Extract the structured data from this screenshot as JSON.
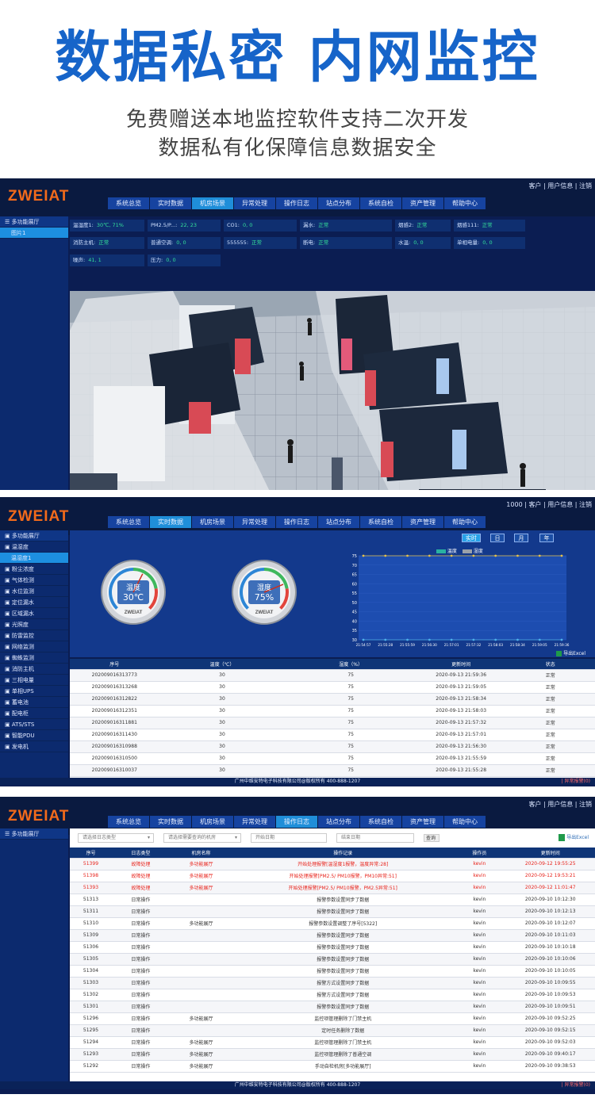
{
  "hero": {
    "title": "数据私密 内网监控",
    "subtitle1": "免费赠送本地监控软件支持二次开发",
    "subtitle2": "数据私有化保障信息数据安全"
  },
  "brand": {
    "logo": "ZWEIAT",
    "accent": "#f26a1b",
    "nav_active": "#1f8ed9"
  },
  "nav": [
    "系统总览",
    "实时数据",
    "机房场景",
    "异常处理",
    "操作日志",
    "站点分布",
    "系统自检",
    "资产管理",
    "帮助中心"
  ],
  "panel1": {
    "user_links": "客户 | 用户信息 | 注销",
    "sidebar": [
      "多功能展厅",
      "图片1"
    ],
    "sensors": [
      {
        "label": "温湿度1:",
        "value": "30℃, 71%"
      },
      {
        "label": "PM2.5/P...:",
        "value": "22, 23"
      },
      {
        "label": "CO1:",
        "value": "0, 0"
      },
      {
        "label": "漏水:",
        "value": "正常"
      },
      {
        "label": "烟感2:",
        "value": "正常"
      },
      {
        "label": "烟感111:",
        "value": "正常"
      },
      {
        "label": "消防主机:",
        "value": "正常"
      },
      {
        "label": "普通空调:",
        "value": "0, 0"
      },
      {
        "label": "555555:",
        "value": "正常"
      },
      {
        "label": "断电:",
        "value": "正常"
      },
      {
        "label": "水温:",
        "value": "0, 0"
      },
      {
        "label": "单相电量:",
        "value": "0, 0"
      },
      {
        "label": "噪声:",
        "value": "41, 1"
      },
      {
        "label": "压力:",
        "value": "0, 0"
      }
    ]
  },
  "panel2": {
    "user_links": "1000 | 客户 | 用户信息 | 注销",
    "sidebar": [
      "多功能展厅",
      "温湿度",
      "温湿度1",
      "粉尘浓度",
      "气体检测",
      "水位监测",
      "定位漏水",
      "区域漏水",
      "光照度",
      "防雷监控",
      "网络监测",
      "蜘蛛监测",
      "消防主机",
      "三相电量",
      "单相UPS",
      "蓄电池",
      "配电柜",
      "ATS/STS",
      "智能PDU",
      "发电机"
    ],
    "gauges": [
      {
        "label": "温度",
        "value": "30℃",
        "brand": "ZWEIAT",
        "level": 0.6
      },
      {
        "label": "湿度",
        "value": "75%",
        "brand": "ZWEIAT",
        "level": 0.75
      }
    ],
    "time_buttons": [
      "实时",
      "日",
      "月",
      "年"
    ],
    "legend": [
      "温度",
      "湿度"
    ],
    "chart_data": {
      "type": "line",
      "x": [
        "21:54:57",
        "21:55:28",
        "21:55:59",
        "21:56:30",
        "21:57:01",
        "21:57:32",
        "21:58:03",
        "21:58:34",
        "21:59:05",
        "21:59:36"
      ],
      "series": [
        {
          "name": "温度",
          "values": [
            75,
            75,
            75,
            75,
            75,
            75,
            75,
            75,
            75,
            75
          ]
        },
        {
          "name": "湿度",
          "values": [
            30,
            30,
            30,
            30,
            30,
            30,
            30,
            30,
            30,
            30
          ]
        }
      ],
      "yticks": [
        "75",
        "70",
        "65",
        "60",
        "55",
        "50",
        "45",
        "40",
        "35",
        "30"
      ],
      "ylim": [
        30,
        75
      ]
    },
    "export_label": "导出Excel",
    "table_headers": [
      "序号",
      "温度（℃）",
      "湿度（%）",
      "更新时间",
      "状态"
    ],
    "rows": [
      [
        "202009016313773",
        "30",
        "75",
        "2020-09-13 21:59:36",
        "正常"
      ],
      [
        "202009016313268",
        "30",
        "75",
        "2020-09-13 21:59:05",
        "正常"
      ],
      [
        "202009016312822",
        "30",
        "75",
        "2020-09-13 21:58:34",
        "正常"
      ],
      [
        "202009016312351",
        "30",
        "75",
        "2020-09-13 21:58:03",
        "正常"
      ],
      [
        "202009016311881",
        "30",
        "75",
        "2020-09-13 21:57:32",
        "正常"
      ],
      [
        "202009016311430",
        "30",
        "75",
        "2020-09-13 21:57:01",
        "正常"
      ],
      [
        "202009016310988",
        "30",
        "75",
        "2020-09-13 21:56:30",
        "正常"
      ],
      [
        "202009016310500",
        "30",
        "75",
        "2020-09-13 21:55:59",
        "正常"
      ],
      [
        "202009016310037",
        "30",
        "75",
        "2020-09-13 21:55:28",
        "正常"
      ]
    ],
    "footer": "广州中维安特电子科技有限公司@版权所有 400-888-1207",
    "alarm": "| 异常报警(0)"
  },
  "panel3": {
    "user_links": "客户 | 用户信息 | 注销",
    "sidebar": [
      "多功能展厅"
    ],
    "filters": {
      "type_placeholder": "请选择日志类型",
      "room_placeholder": "请选择需要查询的机房",
      "start_placeholder": "开始日期",
      "end_placeholder": "结束日期",
      "query": "查询",
      "export": "导出Excel"
    },
    "table_headers": [
      "序号",
      "日志类型",
      "机房名称",
      "操作记录",
      "操作员",
      "更新时间"
    ],
    "rows": [
      [
        "51399",
        "故障处理",
        "多功能展厅",
        "开始处理报警[温湿度1报警，温度异常:28]",
        "kevin",
        "2020-09-12 19:55:25",
        "red"
      ],
      [
        "51398",
        "故障处理",
        "多功能展厅",
        "开始处理报警[PM2.5/ PM10报警，PM10异常:51]",
        "kevin",
        "2020-09-12 19:53:21",
        "red"
      ],
      [
        "51393",
        "故障处理",
        "多功能展厅",
        "开始处理报警[PM2.5/ PM10报警，PM2.5异常:51]",
        "kevin",
        "2020-09-12 11:01:47",
        "red"
      ],
      [
        "51313",
        "日常操作",
        "",
        "报警参数设置同步了数据",
        "kevin",
        "2020-09-10 10:12:30",
        ""
      ],
      [
        "51311",
        "日常操作",
        "",
        "报警参数设置同步了数据",
        "kevin",
        "2020-09-10 10:12:13",
        ""
      ],
      [
        "51310",
        "日常操作",
        "多功能展厅",
        "报警参数设置调整了序号[5322]",
        "kevin",
        "2020-09-10 10:12:07",
        ""
      ],
      [
        "51309",
        "日常操作",
        "",
        "报警参数设置同步了数据",
        "kevin",
        "2020-09-10 10:11:03",
        ""
      ],
      [
        "51306",
        "日常操作",
        "",
        "报警参数设置同步了数据",
        "kevin",
        "2020-09-10 10:10:18",
        ""
      ],
      [
        "51305",
        "日常操作",
        "",
        "报警参数设置同步了数据",
        "kevin",
        "2020-09-10 10:10:06",
        ""
      ],
      [
        "51304",
        "日常操作",
        "",
        "报警参数设置同步了数据",
        "kevin",
        "2020-09-10 10:10:05",
        ""
      ],
      [
        "51303",
        "日常操作",
        "",
        "报警方式设置同步了数据",
        "kevin",
        "2020-09-10 10:09:55",
        ""
      ],
      [
        "51302",
        "日常操作",
        "",
        "报警方式设置同步了数据",
        "kevin",
        "2020-09-10 10:09:53",
        ""
      ],
      [
        "51301",
        "日常操作",
        "",
        "报警参数设置同步了数据",
        "kevin",
        "2020-09-10 10:09:51",
        ""
      ],
      [
        "51296",
        "日常操作",
        "多功能展厅",
        "监控项管理删除了门禁主机",
        "kevin",
        "2020-09-10 09:52:25",
        ""
      ],
      [
        "51295",
        "日常操作",
        "",
        "定时任务删除了数据",
        "kevin",
        "2020-09-10 09:52:15",
        ""
      ],
      [
        "51294",
        "日常操作",
        "多功能展厅",
        "监控项管理删除了门禁主机",
        "kevin",
        "2020-09-10 09:52:03",
        ""
      ],
      [
        "51293",
        "日常操作",
        "多功能展厅",
        "监控项管理删除了普通空调",
        "kevin",
        "2020-09-10 09:40:17",
        ""
      ],
      [
        "51292",
        "日常操作",
        "多功能展厅",
        "手动自检机房[多功能展厅]",
        "kevin",
        "2020-09-10 09:38:53",
        ""
      ]
    ],
    "footer": "广州中维安特电子科技有限公司@版权所有 400-888-1207",
    "alarm": "| 异常报警(0)"
  }
}
